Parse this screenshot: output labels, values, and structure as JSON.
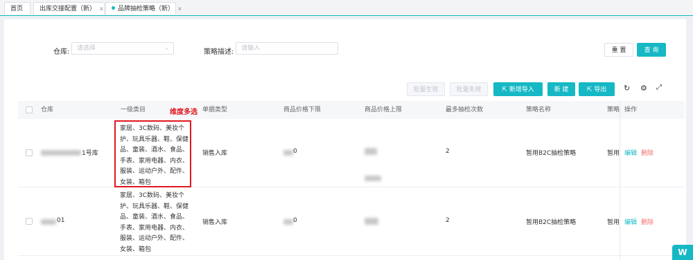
{
  "tabs": [
    {
      "label": "首页",
      "closable": false
    },
    {
      "label": "出库交接配置（新）",
      "closable": true
    },
    {
      "label": "品牌抽检策略（新）",
      "closable": true,
      "active": true
    }
  ],
  "filters": {
    "warehouse": {
      "label": "仓库:",
      "placeholder": "请选择"
    },
    "strategy_desc": {
      "label": "策略描述:",
      "placeholder": "请输入"
    }
  },
  "buttons": {
    "reset": "重 置",
    "search": "查 询",
    "batch_enable": "批量生效",
    "batch_disable": "批量失效",
    "import_new": "新增导入",
    "create": "新 建",
    "export": "导出"
  },
  "annotation": "维度多选",
  "table": {
    "columns": [
      "仓库",
      "一级类目",
      "单据类型",
      "商品价格下限",
      "商品价格上限",
      "最多抽检次数",
      "策略名称",
      "策略",
      "操作"
    ],
    "rows": [
      {
        "warehouse": "1号库",
        "categories": [
          "家居、3C数码、美妆个",
          "护、玩具乐器、鞋、保健",
          "品、童装、酒水、食品、",
          "手表、家用电器、内衣、",
          "服装、运动户外、配件、",
          "女装、箱包"
        ],
        "doc_type": "销售入库",
        "price_min": "0",
        "max_checks": "2",
        "strategy_name": "暂用B2C抽检策略",
        "strategy_trunc": "暂用",
        "edit": "编辑",
        "delete": "删除"
      },
      {
        "warehouse": "01",
        "categories": [
          "家居、3C数码、美妆个",
          "护、玩具乐器、鞋、保健",
          "品、童装、酒水、食品、",
          "手表、家用电器、内衣、",
          "服装、运动户外、配件、",
          "女装、箱包"
        ],
        "doc_type": "销售入库",
        "price_min": "0",
        "max_checks": "2",
        "strategy_name": "暂用B2C抽检策略",
        "strategy_trunc": "暂用",
        "edit": "编辑",
        "delete": "删除"
      }
    ]
  },
  "colors": {
    "accent": "#15b8c4",
    "danger": "#f56c6c",
    "annotation": "#e0171f"
  }
}
